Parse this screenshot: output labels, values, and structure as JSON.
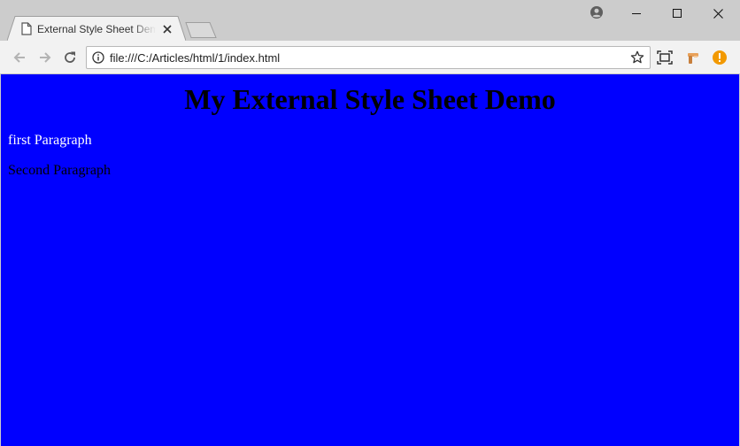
{
  "browser": {
    "tab": {
      "title": "External Style Sheet Demo",
      "favicon": "page-icon",
      "close_icon": "close-icon"
    },
    "new_tab_icon": "new-tab-icon",
    "window_controls": {
      "profile": "profile-icon",
      "minimize": "minimize-icon",
      "maximize": "maximize-icon",
      "close": "close-icon"
    },
    "toolbar": {
      "back": "back-arrow-icon",
      "forward": "forward-arrow-icon",
      "reload": "reload-icon",
      "url": "file:///C:/Articles/html/1/index.html",
      "security_icon": "info-icon",
      "bookmark_icon": "star-icon",
      "extensions": [
        "cast-icon",
        "extension-icon",
        "alert-icon"
      ]
    },
    "colors": {
      "frame": "#cccccc",
      "toolbar": "#f2f2f2",
      "alert": "#f29900"
    }
  },
  "page": {
    "heading": "My External Style Sheet Demo",
    "paragraphs": [
      "first Paragraph",
      "Second Paragraph"
    ],
    "colors": {
      "background": "#0000ff",
      "first_paragraph": "#ffffff",
      "text": "#000000"
    }
  }
}
